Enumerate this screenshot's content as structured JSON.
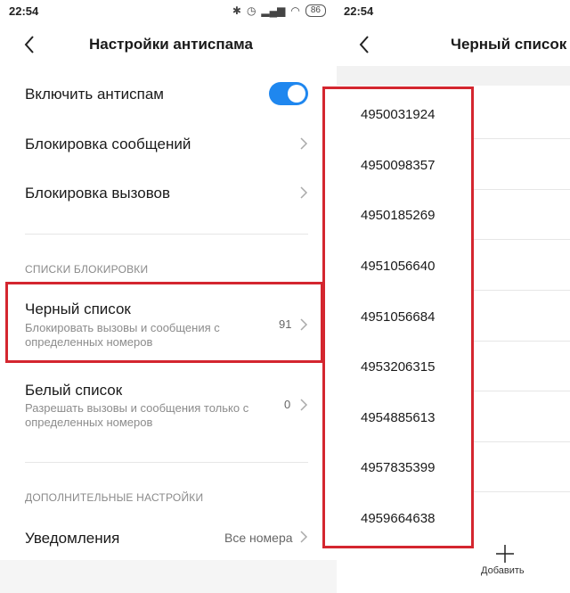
{
  "left": {
    "status_time": "22:54",
    "battery": "86",
    "title": "Настройки антиспама",
    "rows": {
      "enable_antispam": "Включить антиспам",
      "block_messages": "Блокировка сообщений",
      "block_calls": "Блокировка вызовов"
    },
    "section_blocklists": "СПИСКИ БЛОКИРОВКИ",
    "blacklist": {
      "title": "Черный список",
      "subtitle": "Блокировать вызовы и сообщения с определенных номеров",
      "count": "91"
    },
    "whitelist": {
      "title": "Белый список",
      "subtitle": "Разрешать вызовы и сообщения только с определенных номеров",
      "count": "0"
    },
    "section_additional": "ДОПОЛНИТЕЛЬНЫЕ НАСТРОЙКИ",
    "notifications": {
      "title": "Уведомления",
      "value": "Все номера"
    },
    "toggle_on": true,
    "accent_color": "#1f87ef",
    "highlight_color": "#d4262f"
  },
  "right": {
    "status_time": "22:54",
    "title": "Черный список",
    "numbers": [
      "4950031924",
      "4950098357",
      "4950185269",
      "4951056640",
      "4951056684",
      "4953206315",
      "4954885613",
      "4957835399",
      "4959664638"
    ],
    "add_label": "Добавить"
  }
}
